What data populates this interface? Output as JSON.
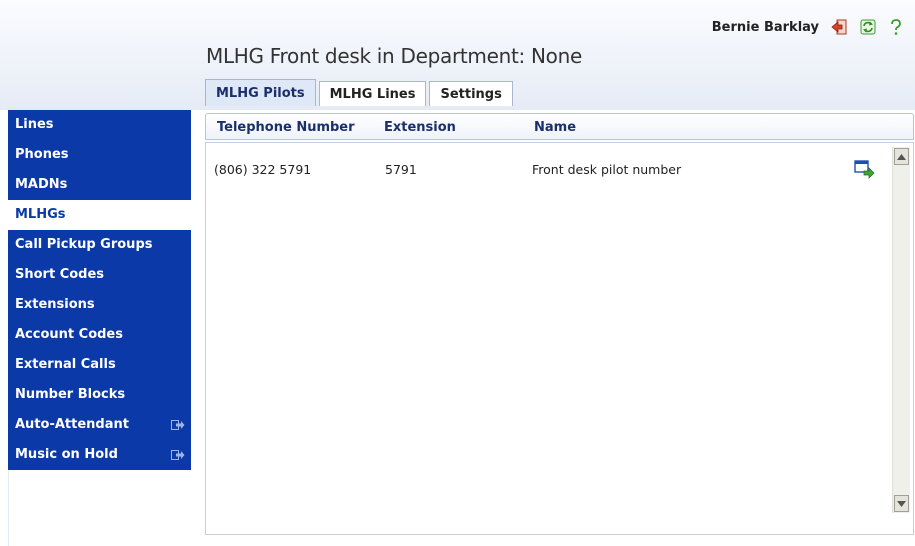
{
  "user": {
    "name": "Bernie Barklay"
  },
  "header_icons": [
    "logout-icon",
    "refresh-icon",
    "help-icon"
  ],
  "page_title": "MLHG Front desk in Department: None",
  "tabs": [
    {
      "label": "MLHG Pilots",
      "active": true
    },
    {
      "label": "MLHG Lines",
      "active": false
    },
    {
      "label": "Settings",
      "active": false
    }
  ],
  "sidebar": {
    "items": [
      {
        "label": "Lines"
      },
      {
        "label": "Phones"
      },
      {
        "label": "MADNs"
      },
      {
        "label": "MLHGs",
        "selected": true
      },
      {
        "label": "Call Pickup Groups"
      },
      {
        "label": "Short Codes"
      },
      {
        "label": "Extensions"
      },
      {
        "label": "Account Codes"
      },
      {
        "label": "External Calls"
      },
      {
        "label": "Number Blocks"
      },
      {
        "label": "Auto-Attendant",
        "external": true
      },
      {
        "label": "Music on Hold",
        "external": true
      }
    ]
  },
  "table": {
    "columns": [
      "Telephone Number",
      "Extension",
      "Name"
    ],
    "rows": [
      {
        "telephone_number": "(806) 322 5791",
        "extension": "5791",
        "name": "Front desk pilot number"
      }
    ]
  },
  "colors": {
    "nav_background": "#0b3aa8",
    "header_text": "#1a2f6b",
    "header_gradient_end": "#e5ebf6"
  }
}
